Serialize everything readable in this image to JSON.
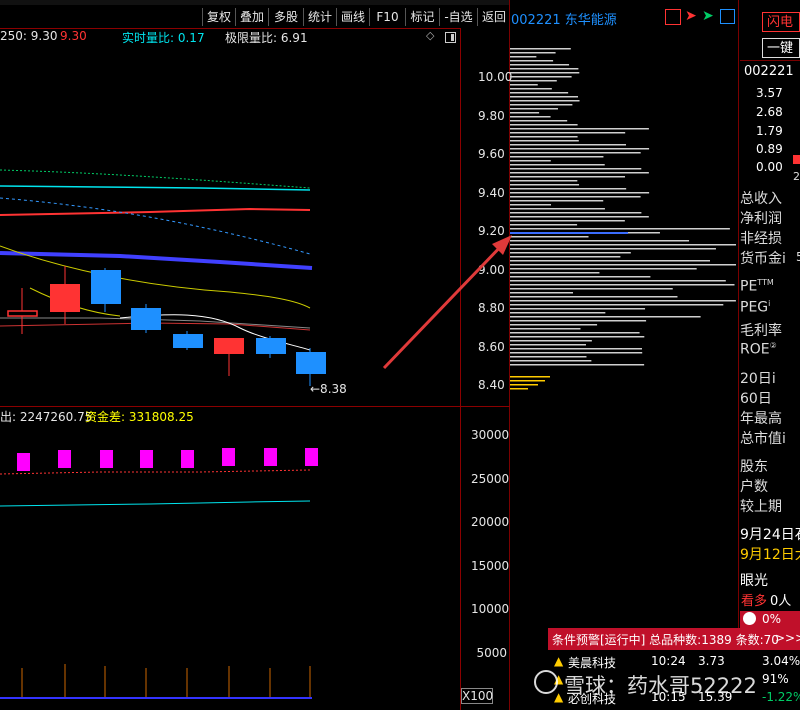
{
  "toolbar": {
    "buttons": [
      "复权",
      "叠加",
      "多股",
      "统计",
      "画线",
      "F10",
      "标记",
      "-自选",
      "返回"
    ]
  },
  "info": {
    "ma_label": "250: 9.30",
    "ma_value": "9.30",
    "realtime_ratio": "实时量比: 0.17",
    "limit_ratio": "极限量比: 6.91"
  },
  "price_axis": [
    "10.00",
    "9.80",
    "9.60",
    "9.40",
    "9.20",
    "9.00",
    "8.80",
    "8.60",
    "8.40"
  ],
  "low_annotation": "←8.38",
  "indicator": {
    "label": "出: 2247260.75",
    "fund_diff": "资金差: 331808.25"
  },
  "volume_axis": [
    "30000",
    "25000",
    "20000",
    "15000",
    "10000",
    "5000"
  ],
  "volume_unit": "X100",
  "stock": {
    "code_name": "002221 东华能源",
    "code": "002221"
  },
  "right_panel": {
    "flash_button": "闪电",
    "one_key_button": "一键",
    "levels": [
      "3.57",
      "2.68",
      "1.79",
      "0.89",
      "0.00"
    ],
    "level_extra": "2",
    "fin_labels": [
      "总收入",
      "净利润",
      "非经损",
      "货币金i"
    ],
    "fin_extra": "5",
    "ratio_labels": [
      "PE",
      "PEG",
      "毛利率",
      "ROE"
    ],
    "pe_sup": "TTM",
    "peg_sup": "i",
    "roe_sup": "②",
    "period_labels": [
      "20日i",
      "60日",
      "年最高",
      "总市值i"
    ],
    "holder_labels": [
      "股东",
      "户数",
      "较上期"
    ],
    "date1": "9月24日石",
    "date2": "9月12日大",
    "eye_label": "眼光",
    "bull_label": "看多",
    "bull_count": "0人",
    "pct_badge": "0%"
  },
  "alert": {
    "header": "条件预警[运行中] 总品种数:1389 条数:70",
    "arrows": ">>>",
    "rows": [
      {
        "name": "美晨科技",
        "time": "10:24",
        "price": "3.73",
        "pct": "3.04%"
      },
      {
        "name": "",
        "time": "",
        "price": "",
        "pct": "91%"
      },
      {
        "name": "必创科技",
        "time": "10:15",
        "price": "15.39",
        "pct": "-1.22%"
      }
    ]
  },
  "watermark": "雪球：药水哥52222",
  "colors": {
    "up": "#ff3333",
    "down": "#1e90ff",
    "grid": "#8b0000",
    "cyan": "#00e5ee",
    "yellow": "#ffff00",
    "magenta": "#ff00ff",
    "blue_ma": "#4040ff"
  }
}
